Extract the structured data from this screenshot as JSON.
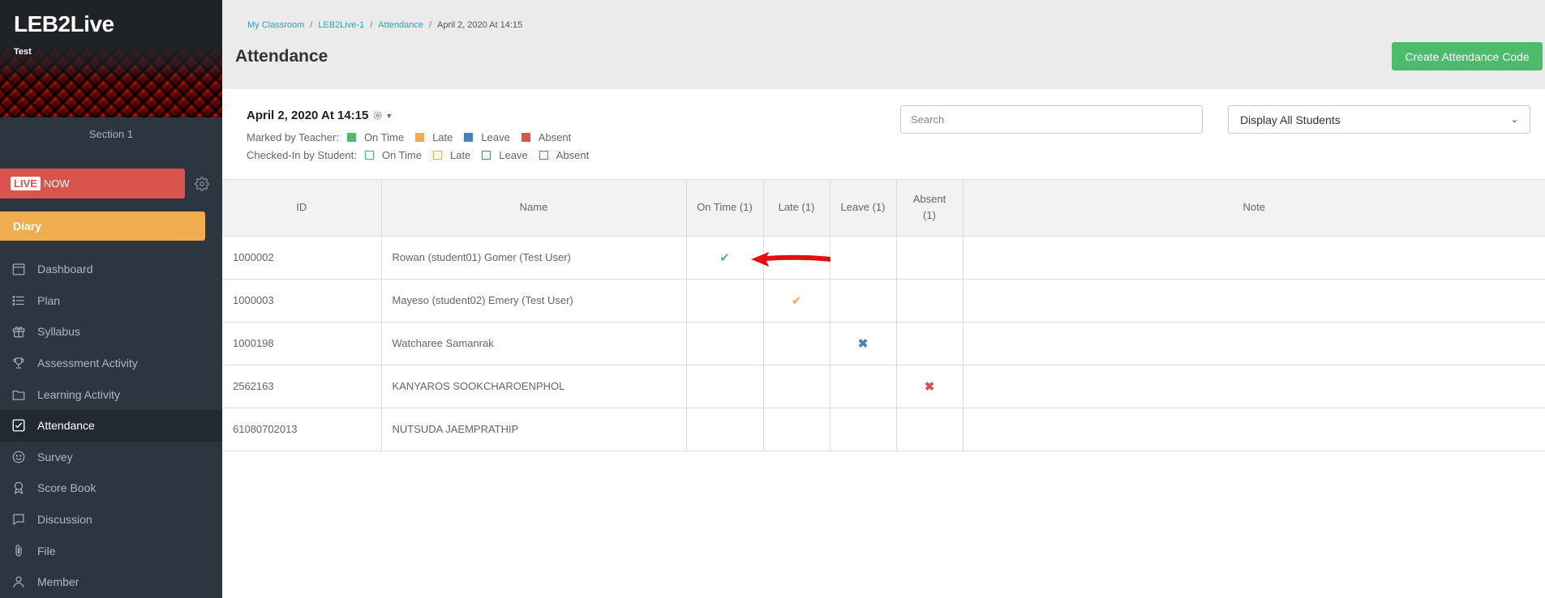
{
  "sidebar": {
    "title": "LEB2Live",
    "subtitle": "Test",
    "section": "Section 1",
    "live_tag": "LIVE",
    "live_text": "NOW",
    "diary": "Diary",
    "items": [
      {
        "label": "Dashboard",
        "icon": "calendar-icon"
      },
      {
        "label": "Plan",
        "icon": "list-icon"
      },
      {
        "label": "Syllabus",
        "icon": "gift-icon"
      },
      {
        "label": "Assessment Activity",
        "icon": "trophy-icon"
      },
      {
        "label": "Learning Activity",
        "icon": "folder-icon"
      },
      {
        "label": "Attendance",
        "icon": "checkbox-icon",
        "active": true
      },
      {
        "label": "Survey",
        "icon": "smiley-icon"
      },
      {
        "label": "Score Book",
        "icon": "award-icon"
      },
      {
        "label": "Discussion",
        "icon": "chat-icon"
      },
      {
        "label": "File",
        "icon": "paperclip-icon"
      },
      {
        "label": "Member",
        "icon": "user-icon"
      }
    ]
  },
  "header": {
    "breadcrumb": [
      "My Classroom",
      "LEB2Live-1",
      "Attendance",
      "April 2, 2020 At 14:15"
    ],
    "title": "Attendance",
    "create_button": "Create Attendance Code"
  },
  "toolbar": {
    "session_title": "April 2, 2020 At 14:15",
    "marked_by_teacher_label": "Marked by Teacher:",
    "checked_in_label": "Checked-In by Student:",
    "legend": [
      "On Time",
      "Late",
      "Leave",
      "Absent"
    ],
    "legend_colors": [
      "#4cbb6c",
      "#f0ad4e",
      "#4a7fc1",
      "#d9534f"
    ],
    "search_placeholder": "Search",
    "filter_selected": "Display All Students"
  },
  "table": {
    "headers": {
      "id": "ID",
      "name": "Name",
      "on_time": "On Time (1)",
      "late": "Late (1)",
      "leave": "Leave (1)",
      "absent": "Absent (1)",
      "note": "Note"
    },
    "rows": [
      {
        "id": "1000002",
        "name": "Rowan (student01) Gomer (Test User)",
        "status": "on_time"
      },
      {
        "id": "1000003",
        "name": "Mayeso (student02) Emery (Test User)",
        "status": "late"
      },
      {
        "id": "1000198",
        "name": "Watcharee Samanrak",
        "status": "leave"
      },
      {
        "id": "2562163",
        "name": "KANYAROS SOOKCHAROENPHOL",
        "status": "absent"
      },
      {
        "id": "61080702013",
        "name": "NUTSUDA JAEMPRATHIP",
        "status": ""
      }
    ]
  }
}
